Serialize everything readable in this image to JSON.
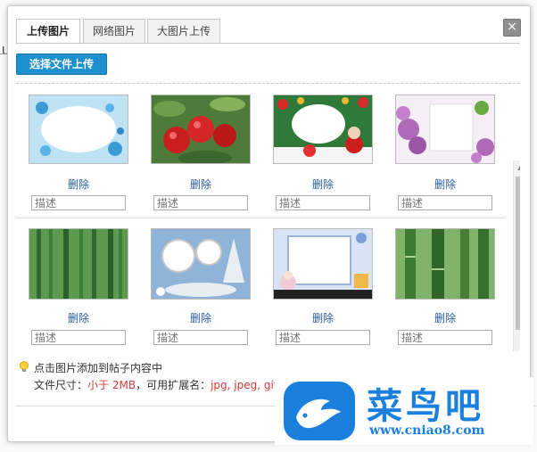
{
  "backdrop": {
    "text": "U"
  },
  "dialog": {
    "close_symbol": "×",
    "tabs": [
      {
        "label": "上传图片",
        "active": true
      },
      {
        "label": "网络图片",
        "active": false
      },
      {
        "label": "大图片上传",
        "active": false
      }
    ],
    "upload_button": "选择文件上传",
    "gallery": {
      "delete_label": "删除",
      "description_placeholder": "描述",
      "images": [
        {
          "subject": "blue flower frame"
        },
        {
          "subject": "red apples on tree"
        },
        {
          "subject": "christmas frame"
        },
        {
          "subject": "lilac love card"
        },
        {
          "subject": "bamboo forest"
        },
        {
          "subject": "fairy frames"
        },
        {
          "subject": "anime girl frame"
        },
        {
          "subject": "green bamboo stalks"
        }
      ]
    },
    "info": {
      "line1": "点击图片添加到帖子内容中",
      "line2_prefix": "文件尺寸：",
      "size_limit": "小于 2MB",
      "line2_mid": "，可用扩展名：",
      "extensions": "jpg, jpeg, gif, p"
    }
  },
  "watermark": {
    "logo_text": "菜鸟吧",
    "url": "www.cniao8.com",
    "color": "#1a7fdd"
  }
}
